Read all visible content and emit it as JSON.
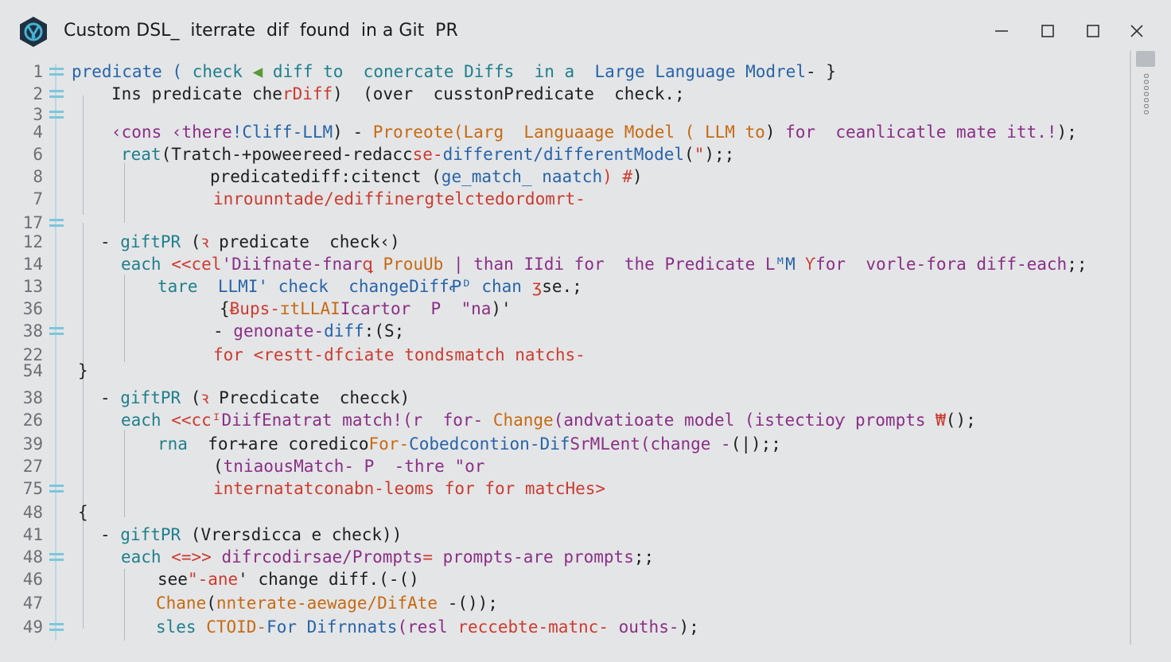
{
  "window": {
    "title": "Custom DSL_  iterrate  dif  found  in a Git  PR",
    "icon": "app-logo-icon",
    "controls": [
      "minimize-icon",
      "restore-icon",
      "maximize-icon",
      "close-icon"
    ]
  },
  "colors": {
    "background": "#e4e5e7",
    "keyword_teal": "#1f7f8c",
    "keyword_blue": "#2764a8",
    "purple": "#8a2f86",
    "orange": "#c76a12",
    "red": "#cc3b2f",
    "dark": "#1e1e1e",
    "gutter_marker": "#7cc7dc"
  },
  "minimap": {
    "label": "ooooooo"
  },
  "lines": [
    {
      "num": "1",
      "marker": true,
      "segs": [
        {
          "t": "predicate (",
          "c": "#2764a8"
        },
        {
          "t": " check ",
          "c": "#1f7f8c"
        },
        {
          "t": "◀ ",
          "c": "#5a9a3a"
        },
        {
          "t": "diff to  conercate Diffs  in a  ",
          "c": "#1f7f8c"
        },
        {
          "t": "Large Language Modrel",
          "c": "#2764a8"
        },
        {
          "t": "- }",
          "c": "#1e1e1e"
        }
      ]
    },
    {
      "num": "2",
      "marker": true,
      "segs": [
        {
          "t": "Ins predicate che",
          "c": "#1e1e1e"
        },
        {
          "t": "rDiff",
          "c": "#cc3b2f"
        },
        {
          "t": ")  (over  cusstonPredicate  check.;",
          "c": "#1e1e1e"
        }
      ]
    },
    {
      "num": "3",
      "marker": true,
      "segs": []
    },
    {
      "num": "4",
      "marker": false,
      "segs": [
        {
          "t": "‹cons ‹there",
          "c": "#8a2f86"
        },
        {
          "t": "!Cliff-LLM",
          "c": "#2764a8"
        },
        {
          "t": ") - ",
          "c": "#1e1e1e"
        },
        {
          "t": "Proreote(Larg  Languaage Model ( LLM to",
          "c": "#c76a12"
        },
        {
          "t": ") ",
          "c": "#1e1e1e"
        },
        {
          "t": "for  ceanlicatle mate itt.!",
          "c": "#8a2f86"
        },
        {
          "t": ");",
          "c": "#1e1e1e"
        }
      ]
    },
    {
      "num": "6",
      "marker": false,
      "segs": [
        {
          "t": "reat",
          "c": "#1f7f8c"
        },
        {
          "t": "(Tratch-+poweereed-redacc",
          "c": "#1e1e1e"
        },
        {
          "t": "se-",
          "c": "#cc3b2f"
        },
        {
          "t": "different/differentModel",
          "c": "#2764a8"
        },
        {
          "t": "(",
          "c": "#1e1e1e"
        },
        {
          "t": "\"",
          "c": "#cc3b2f"
        },
        {
          "t": ");;",
          "c": "#1e1e1e"
        }
      ]
    },
    {
      "num": "8",
      "marker": false,
      "segs": [
        {
          "t": "predicatediff:citenct (",
          "c": "#1e1e1e"
        },
        {
          "t": "ge_match_ naatch",
          "c": "#2764a8"
        },
        {
          "t": ") #",
          "c": "#cc3b2f"
        },
        {
          "t": ")",
          "c": "#1e1e1e"
        }
      ]
    },
    {
      "num": "7",
      "marker": false,
      "segs": [
        {
          "t": "inrounntade/ediffinergtelctedordomrt-",
          "c": "#cc3b2f"
        }
      ]
    },
    {
      "num": "17",
      "marker": true,
      "segs": []
    },
    {
      "num": "12",
      "marker": false,
      "segs": [
        {
          "t": "- ",
          "c": "#1e1e1e"
        },
        {
          "t": "giftPR",
          "c": "#1f7f8c"
        },
        {
          "t": " (",
          "c": "#1e1e1e"
        },
        {
          "t": "ꝛ",
          "c": "#cc3b2f"
        },
        {
          "t": " predicate  check",
          "c": "#1e1e1e"
        },
        {
          "t": "‹)",
          "c": "#1e1e1e"
        }
      ]
    },
    {
      "num": "14",
      "marker": false,
      "segs": [
        {
          "t": "each ",
          "c": "#1f7f8c"
        },
        {
          "t": "<<cel",
          "c": "#cc3b2f"
        },
        {
          "t": "'Diifnate-fnar",
          "c": "#8a2f86"
        },
        {
          "t": "ꝗ ",
          "c": "#cc3b2f"
        },
        {
          "t": "ProuUb ",
          "c": "#c76a12"
        },
        {
          "t": "| than IIdi for  the Predicate L",
          "c": "#8a2f86"
        },
        {
          "t": "ᴹM ",
          "c": "#2764a8"
        },
        {
          "t": "Ƴ",
          "c": "#cc3b2f"
        },
        {
          "t": "for  ",
          "c": "#8a2f86"
        },
        {
          "t": "vorle-fora diff-each",
          "c": "#8a2f86"
        },
        {
          "t": ";;",
          "c": "#1e1e1e"
        }
      ]
    },
    {
      "num": "13",
      "marker": false,
      "segs": [
        {
          "t": "tare  ",
          "c": "#1f7f8c"
        },
        {
          "t": "LLMI' check  changeDiffꝒ",
          "c": "#2764a8"
        },
        {
          "t": "ᴰ chan ",
          "c": "#2764a8"
        },
        {
          "t": "ʒ",
          "c": "#cc3b2f"
        },
        {
          "t": "se.;",
          "c": "#1e1e1e"
        }
      ]
    },
    {
      "num": "36",
      "marker": false,
      "segs": [
        {
          "t": "{",
          "c": "#1e1e1e"
        },
        {
          "t": "Ƀups-",
          "c": "#cc3b2f"
        },
        {
          "t": "ɪtLLAI",
          "c": "#c76a12"
        },
        {
          "t": "Icartor  P  ",
          "c": "#8a2f86"
        },
        {
          "t": "\"na",
          "c": "#8a2f86"
        },
        {
          "t": ")'",
          "c": "#1e1e1e"
        }
      ]
    },
    {
      "num": "38",
      "marker": true,
      "segs": [
        {
          "t": "- ",
          "c": "#1e1e1e"
        },
        {
          "t": "genonate-",
          "c": "#8a2f86"
        },
        {
          "t": "diff",
          "c": "#2764a8"
        },
        {
          "t": ":(S;",
          "c": "#1e1e1e"
        }
      ]
    },
    {
      "num": "22",
      "marker": false,
      "segs": [
        {
          "t": "for <restt-dfciate tondsmatch natchs-",
          "c": "#cc3b2f"
        }
      ]
    },
    {
      "num": "54",
      "marker": false,
      "segs": [
        {
          "t": "}",
          "c": "#1e1e1e"
        }
      ]
    },
    {
      "num": "38",
      "marker": false,
      "segs": [
        {
          "t": "- ",
          "c": "#1e1e1e"
        },
        {
          "t": "giftPR",
          "c": "#1f7f8c"
        },
        {
          "t": " (",
          "c": "#1e1e1e"
        },
        {
          "t": "ꝛ",
          "c": "#cc3b2f"
        },
        {
          "t": " Precdicate  checck)",
          "c": "#1e1e1e"
        }
      ]
    },
    {
      "num": "26",
      "marker": false,
      "segs": [
        {
          "t": "each ",
          "c": "#1f7f8c"
        },
        {
          "t": "<<cc",
          "c": "#cc3b2f"
        },
        {
          "t": "ᴵ",
          "c": "#cc3b2f"
        },
        {
          "t": "DiifEnatrat match",
          "c": "#8a2f86"
        },
        {
          "t": "!(r  for- ",
          "c": "#8a2f86"
        },
        {
          "t": "Change",
          "c": "#c76a12"
        },
        {
          "t": "(andvatioate",
          "c": "#8a2f86"
        },
        {
          "t": " model ",
          "c": "#8a2f86"
        },
        {
          "t": "(istectioƴ prompts ",
          "c": "#8a2f86"
        },
        {
          "t": "₩",
          "c": "#cc3b2f"
        },
        {
          "t": "();",
          "c": "#1e1e1e"
        }
      ]
    },
    {
      "num": "39",
      "marker": false,
      "segs": [
        {
          "t": "rna  ",
          "c": "#1f7f8c"
        },
        {
          "t": "for+are coredico",
          "c": "#1e1e1e"
        },
        {
          "t": "For-",
          "c": "#c76a12"
        },
        {
          "t": "Cobedcontion",
          "c": "#2764a8"
        },
        {
          "t": "-Dif",
          "c": "#2764a8"
        },
        {
          "t": "SrML",
          "c": "#8a2f86"
        },
        {
          "t": "ent(change -",
          "c": "#8a2f86"
        },
        {
          "t": "(|);;",
          "c": "#1e1e1e"
        }
      ]
    },
    {
      "num": "27",
      "marker": false,
      "segs": [
        {
          "t": "(",
          "c": "#1e1e1e"
        },
        {
          "t": "tniaousMatch-",
          "c": "#8a2f86"
        },
        {
          "t": " P  ",
          "c": "#8a2f86"
        },
        {
          "t": "-thre ",
          "c": "#8a2f86"
        },
        {
          "t": "\"or",
          "c": "#8a2f86"
        }
      ]
    },
    {
      "num": "75",
      "marker": true,
      "segs": [
        {
          "t": "internatatconabn-leoms for for matcHes>",
          "c": "#cc3b2f"
        }
      ]
    },
    {
      "num": "48",
      "marker": false,
      "segs": [
        {
          "t": "{",
          "c": "#1e1e1e"
        }
      ]
    },
    {
      "num": "41",
      "marker": false,
      "segs": [
        {
          "t": "- ",
          "c": "#1e1e1e"
        },
        {
          "t": "giftPR",
          "c": "#1f7f8c"
        },
        {
          "t": " (",
          "c": "#1e1e1e"
        },
        {
          "t": "Vrersdicca",
          "c": "#1e1e1e"
        },
        {
          "t": " e check)",
          "c": "#1e1e1e"
        },
        {
          "t": ")",
          "c": "#1e1e1e"
        }
      ]
    },
    {
      "num": "48",
      "marker": true,
      "segs": [
        {
          "t": "each ",
          "c": "#1f7f8c"
        },
        {
          "t": "<=>> ",
          "c": "#cc3b2f"
        },
        {
          "t": "difr",
          "c": "#8a2f86"
        },
        {
          "t": "codirsae",
          "c": "#8a2f86"
        },
        {
          "t": "/Prompts",
          "c": "#8a2f86"
        },
        {
          "t": "= ",
          "c": "#cc3b2f"
        },
        {
          "t": "prompts-are prompts",
          "c": "#8a2f86"
        },
        {
          "t": ";;",
          "c": "#1e1e1e"
        }
      ]
    },
    {
      "num": "46",
      "marker": false,
      "segs": [
        {
          "t": "see",
          "c": "#1e1e1e"
        },
        {
          "t": "\"-ane",
          "c": "#cc3b2f"
        },
        {
          "t": "' change diff.",
          "c": "#1e1e1e"
        },
        {
          "t": "(-()",
          "c": "#1e1e1e"
        }
      ]
    },
    {
      "num": "47",
      "marker": false,
      "segs": [
        {
          "t": "Chane",
          "c": "#c76a12"
        },
        {
          "t": "(",
          "c": "#1e1e1e"
        },
        {
          "t": "nnterate-aewage",
          "c": "#c76a12"
        },
        {
          "t": "/DifAte",
          "c": "#c76a12"
        },
        {
          "t": " -(",
          "c": "#1e1e1e"
        },
        {
          "t": ")",
          "c": "#1e1e1e"
        },
        {
          "t": ");",
          "c": "#1e1e1e"
        }
      ]
    },
    {
      "num": "49",
      "marker": true,
      "segs": [
        {
          "t": "sles ",
          "c": "#1f7f8c"
        },
        {
          "t": "CTOID-",
          "c": "#c76a12"
        },
        {
          "t": "For Difrnnats",
          "c": "#2764a8"
        },
        {
          "t": "(resl ",
          "c": "#8a2f86"
        },
        {
          "t": "reccebt",
          "c": "#cc3b2f"
        },
        {
          "t": "e-matnc-",
          "c": "#cc3b2f"
        },
        {
          "t": " ouths-",
          "c": "#8a2f86"
        },
        {
          "t": ");",
          "c": "#1e1e1e"
        }
      ]
    }
  ]
}
